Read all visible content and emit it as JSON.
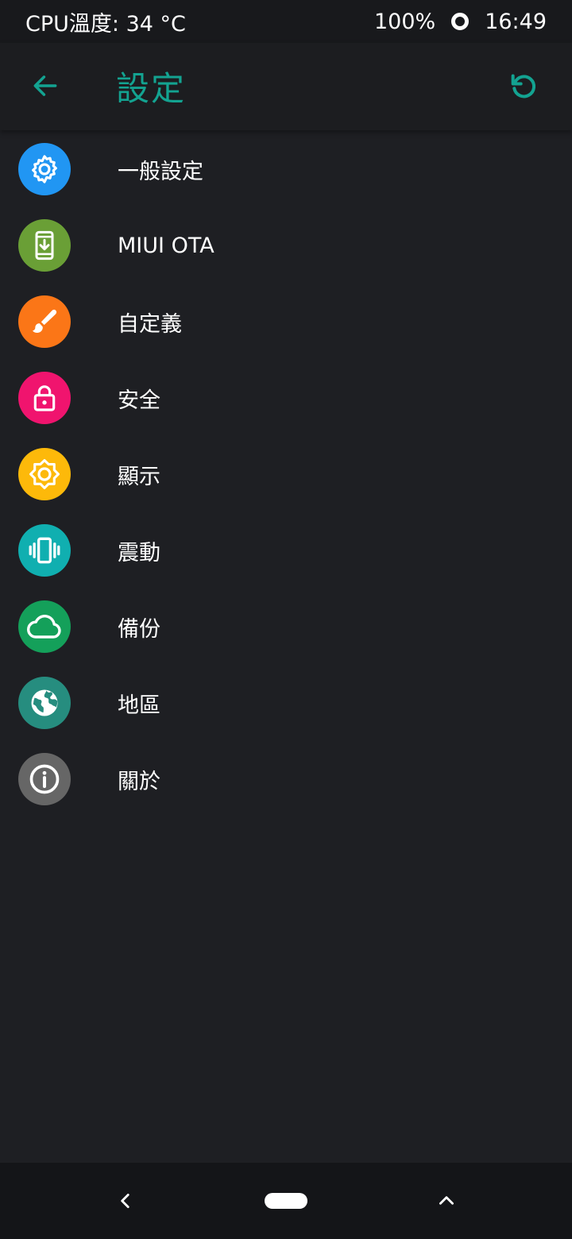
{
  "status_bar": {
    "cpu_temp": "CPU溫度: 34 °C",
    "battery": "100%",
    "time": "16:49"
  },
  "app_bar": {
    "title": "設定",
    "accent_color": "#13a391"
  },
  "menu": {
    "items": [
      {
        "label": "一般設定",
        "icon": "gear-icon",
        "color": "#2196f3"
      },
      {
        "label": "MIUI OTA",
        "icon": "phone-download-icon",
        "color": "#6a9f36"
      },
      {
        "label": "自定義",
        "icon": "paintbrush-icon",
        "color": "#fb7617"
      },
      {
        "label": "安全",
        "icon": "lock-icon",
        "color": "#f0146e"
      },
      {
        "label": "顯示",
        "icon": "brightness-icon",
        "color": "#fdb90a"
      },
      {
        "label": "震動",
        "icon": "vibration-icon",
        "color": "#10afb0"
      },
      {
        "label": "備份",
        "icon": "cloud-icon",
        "color": "#14a05a"
      },
      {
        "label": "地區",
        "icon": "globe-icon",
        "color": "#268d7f"
      },
      {
        "label": "關於",
        "icon": "info-icon",
        "color": "#666666"
      }
    ]
  },
  "navigation": {
    "back_icon": "chevron-left-icon",
    "home_icon": "home-pill-icon",
    "recents_icon": "chevron-up-icon"
  }
}
